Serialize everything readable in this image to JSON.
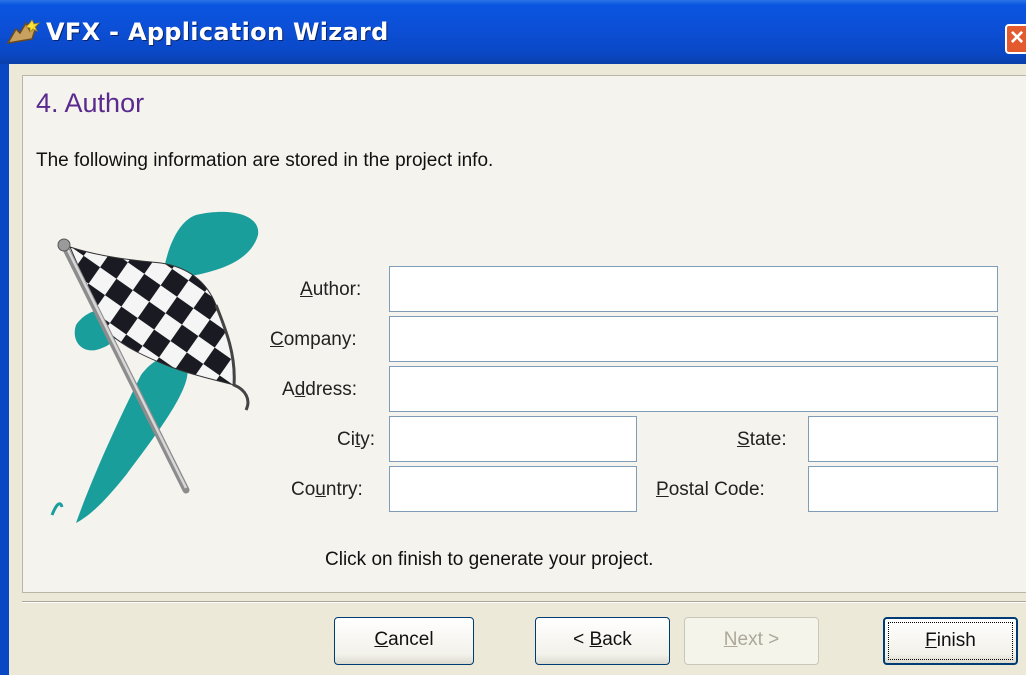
{
  "window": {
    "title": "VFX - Application Wizard",
    "app_icon": "wizard-icon",
    "close_icon": "close-icon",
    "accent": "#0a47c4"
  },
  "step": {
    "title": "4. Author",
    "subtitle": "The following information are stored in the project info.",
    "illustration": "checkered-flag-icon",
    "title_color": "#5a2a8e"
  },
  "form": {
    "author": {
      "label_mnemonic": "A",
      "label_rest": "uthor:",
      "value": ""
    },
    "company": {
      "label_mnemonic": "C",
      "label_rest": "ompany:",
      "value": ""
    },
    "address": {
      "label_pre": "A",
      "label_mnemonic": "d",
      "label_rest": "dress:",
      "value": ""
    },
    "city": {
      "label_pre": "Ci",
      "label_mnemonic": "t",
      "label_rest": "y:",
      "value": ""
    },
    "state": {
      "label_mnemonic": "S",
      "label_rest": "tate:",
      "value": ""
    },
    "country": {
      "label_pre": "Co",
      "label_mnemonic": "u",
      "label_rest": "ntry:",
      "value": ""
    },
    "postal_code": {
      "label_mnemonic": "P",
      "label_rest": "ostal Code:",
      "value": ""
    }
  },
  "hint": "Click on finish to generate your project.",
  "buttons": {
    "cancel": {
      "mnemonic": "C",
      "rest": "ancel"
    },
    "back": {
      "pre": "< ",
      "mnemonic": "B",
      "rest": "ack"
    },
    "next": {
      "mnemonic": "N",
      "rest": "ext >",
      "enabled": false
    },
    "finish": {
      "mnemonic": "F",
      "rest": "inish",
      "default": true
    }
  }
}
